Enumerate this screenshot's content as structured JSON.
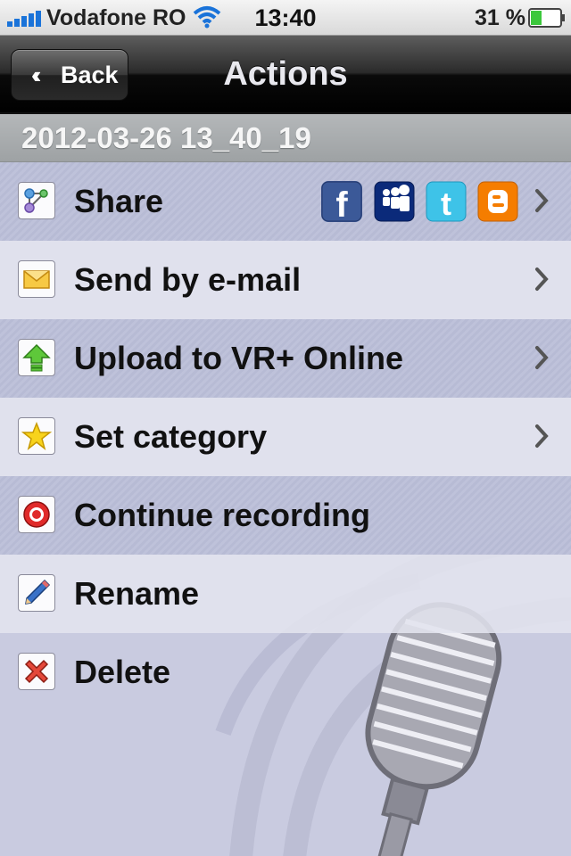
{
  "status": {
    "carrier": "Vodafone RO",
    "time": "13:40",
    "battery": "31 %",
    "icons": [
      "signal-bars-icon",
      "wifi-icon",
      "battery-icon"
    ]
  },
  "nav": {
    "back_label": "Back",
    "title": "Actions"
  },
  "recording": {
    "name": "2012-03-26 13_40_19"
  },
  "actions": [
    {
      "label": "Share",
      "icon": "share-icon",
      "has_chevron": true
    },
    {
      "label": "Send by e-mail",
      "icon": "envelope-icon",
      "has_chevron": true
    },
    {
      "label": "Upload to VR+ Online",
      "icon": "upload-arrow-icon",
      "has_chevron": true
    },
    {
      "label": "Set category",
      "icon": "star-icon",
      "has_chevron": true
    },
    {
      "label": "Continue recording",
      "icon": "record-icon",
      "has_chevron": false
    },
    {
      "label": "Rename",
      "icon": "pencil-icon",
      "has_chevron": false
    },
    {
      "label": "Delete",
      "icon": "delete-x-icon",
      "has_chevron": false
    }
  ],
  "share_services": [
    "facebook-icon",
    "myspace-icon",
    "twitter-icon",
    "blogger-icon"
  ],
  "colors": {
    "row_dark": "#bcbfd9",
    "row_light": "#e3e5ee",
    "navbar": "#000000",
    "facebook": "#3b5998",
    "myspace": "#0b2a7a",
    "twitter": "#3ec3e8",
    "blogger": "#f57d00"
  }
}
